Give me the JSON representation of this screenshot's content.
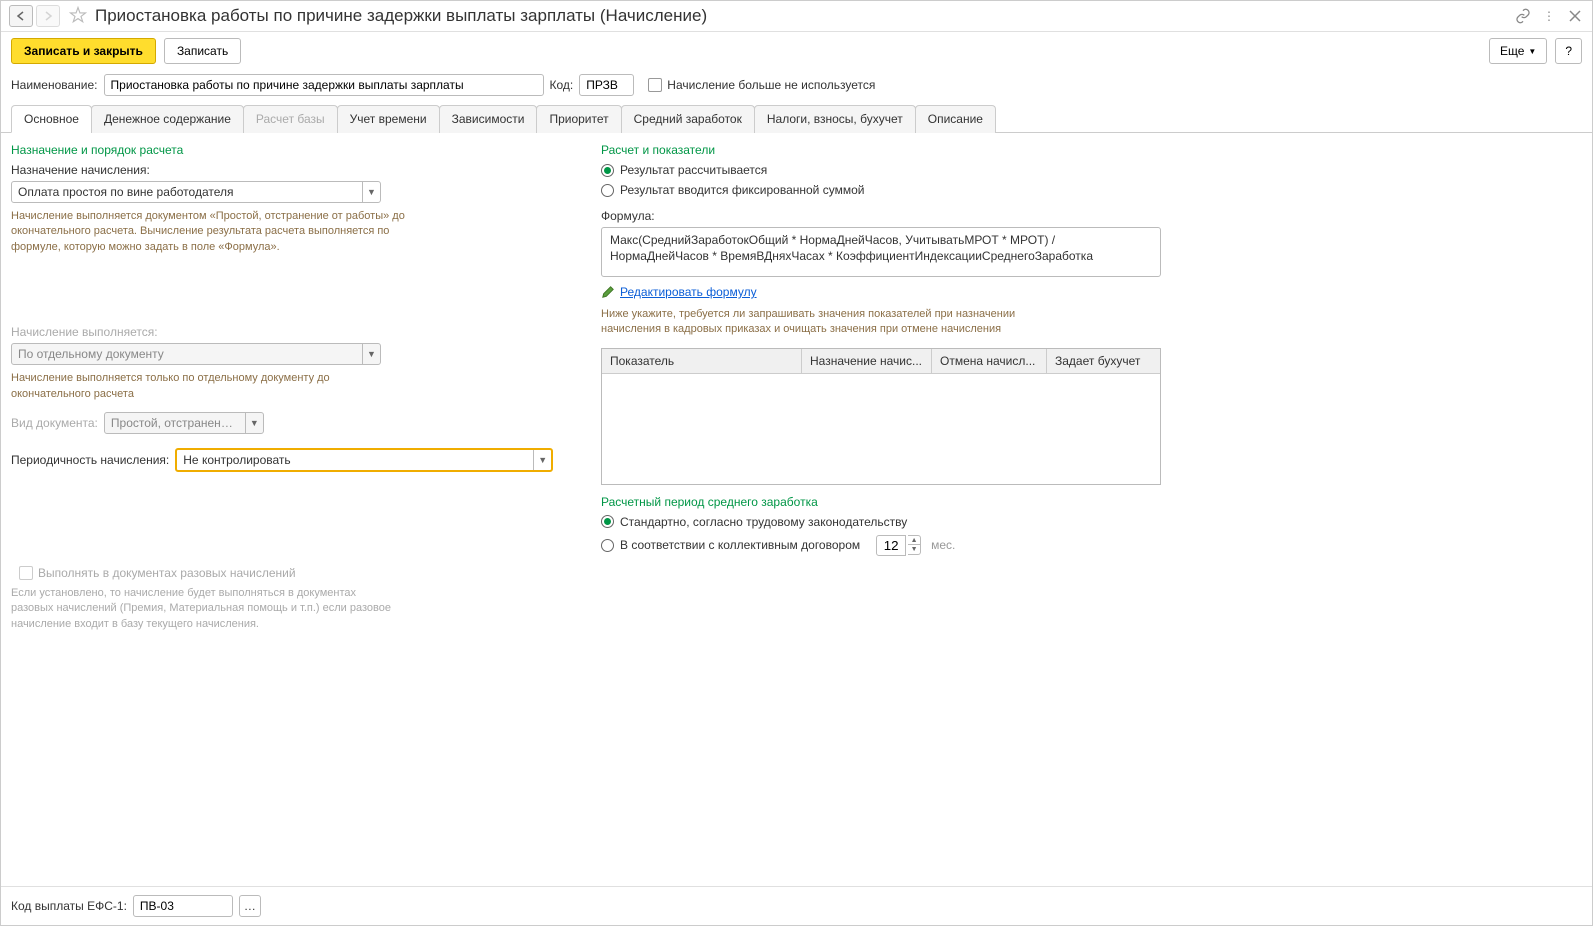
{
  "titlebar": {
    "title": "Приостановка работы по причине задержки выплаты зарплаты (Начисление)"
  },
  "toolbar": {
    "save_close": "Записать и закрыть",
    "save": "Записать",
    "more": "Еще",
    "help": "?"
  },
  "header": {
    "name_label": "Наименование:",
    "name_value": "Приостановка работы по причине задержки выплаты зарплаты",
    "code_label": "Код:",
    "code_value": "ПРЗВ",
    "not_used_label": "Начисление больше не используется"
  },
  "tabs": [
    {
      "label": "Основное",
      "active": true
    },
    {
      "label": "Денежное содержание"
    },
    {
      "label": "Расчет базы",
      "disabled": true
    },
    {
      "label": "Учет времени"
    },
    {
      "label": "Зависимости"
    },
    {
      "label": "Приоритет"
    },
    {
      "label": "Средний заработок"
    },
    {
      "label": "Налоги, взносы, бухучет"
    },
    {
      "label": "Описание"
    }
  ],
  "left": {
    "section1_title": "Назначение и порядок расчета",
    "purpose_label": "Назначение начисления:",
    "purpose_value": "Оплата простоя по вине работодателя",
    "purpose_hint": "Начисление выполняется документом «Простой, отстранение от работы» до окончательного расчета. Вычисление результата расчета выполняется по формуле, которую можно задать в поле «Формула».",
    "perform_label": "Начисление выполняется:",
    "perform_value": "По отдельному документу",
    "perform_hint": "Начисление выполняется только по отдельному документу до окончательного расчета",
    "doctype_label": "Вид документа:",
    "doctype_value": "Простой, отстранение от р",
    "period_label": "Периодичность начисления:",
    "period_value": "Не контролировать",
    "onetime_label": "Выполнять в документах разовых начислений",
    "onetime_hint": "Если установлено, то начисление будет выполняться в документах разовых начислений (Премия, Материальная помощь и т.п.) если разовое начисление входит в базу текущего начисления."
  },
  "right": {
    "section1_title": "Расчет и показатели",
    "radio_calc": "Результат рассчитывается",
    "radio_fixed": "Результат вводится фиксированной суммой",
    "formula_label": "Формула:",
    "formula_text": "Макс(СреднийЗаработокОбщий * НормаДнейЧасов, УчитыватьМРОТ * МРОТ) / НормаДнейЧасов * ВремяВДняхЧасах * КоэффициентИндексацииСреднегоЗаработка",
    "edit_formula": "Редактировать формулу",
    "indicators_hint": "Ниже укажите, требуется ли запрашивать значения показателей при назначении начисления в кадровых приказах и очищать значения при отмене начисления",
    "table_headers": [
      "Показатель",
      "Назначение начис...",
      "Отмена начисл...",
      "Задает бухучет"
    ],
    "section2_title": "Расчетный период среднего заработка",
    "radio_standard": "Стандартно, согласно трудовому законодательству",
    "radio_collective": "В соответствии с коллективным договором",
    "months_value": "12",
    "months_label": "мес."
  },
  "footer": {
    "efs_label": "Код выплаты ЕФС-1:",
    "efs_value": "ПВ-03"
  }
}
